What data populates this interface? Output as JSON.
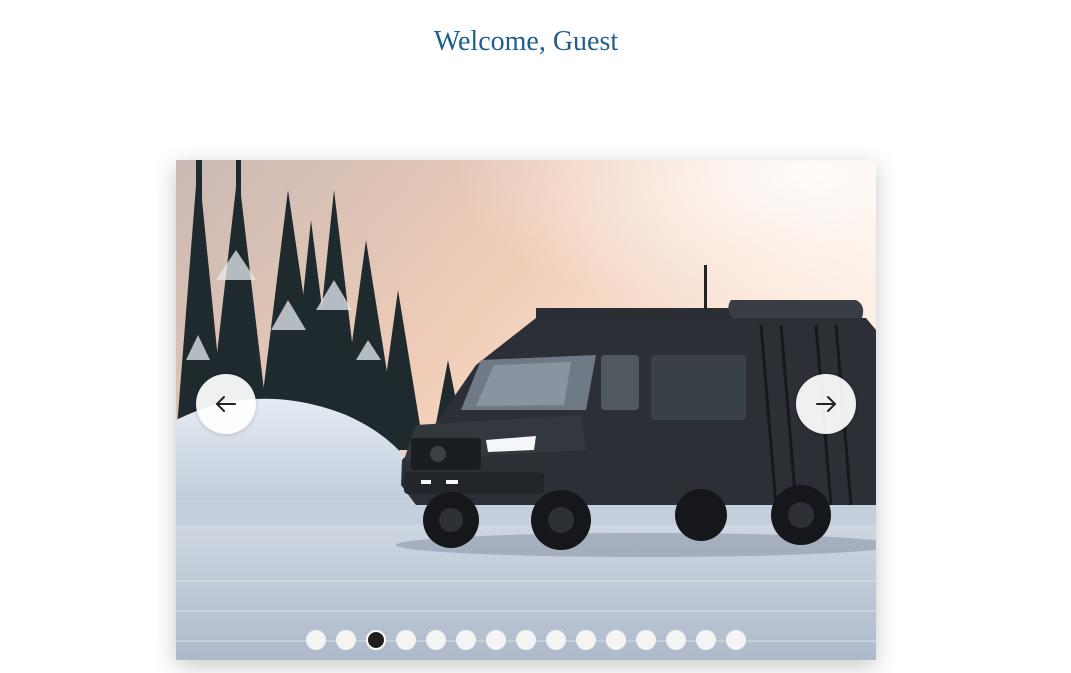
{
  "header": {
    "welcome_text": "Welcome, Guest"
  },
  "carousel": {
    "prev_label": "prev",
    "next_label": "next",
    "prev_icon": "arrow-left-icon",
    "next_icon": "arrow-right-icon",
    "slide_count": 15,
    "active_index": 2,
    "colors": {
      "title": "#1f5f8b",
      "dot": "#f4f4f4",
      "dot_active": "#1e1e1e"
    }
  }
}
